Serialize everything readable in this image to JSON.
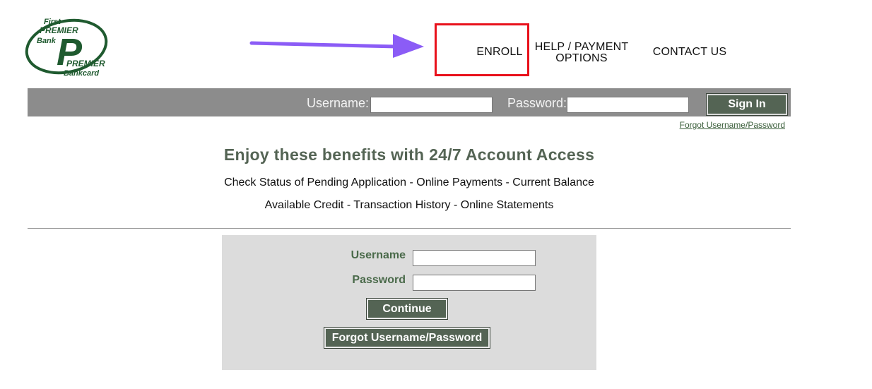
{
  "logo": {
    "line1": "First",
    "line2": "PREMIER",
    "line3": "Bank",
    "line4": "PREMIER",
    "line5": "Bankcard",
    "letter": "P",
    "color": "#1f5a2f"
  },
  "nav": {
    "enroll": "ENROLL",
    "help_line1": "HELP / PAYMENT",
    "help_line2": "OPTIONS",
    "contact": "CONTACT US"
  },
  "annotation": {
    "arrow_color": "#8b5cf6",
    "box_color": "#e8111b"
  },
  "login_bar": {
    "username_label": "Username:",
    "password_label": "Password:",
    "username_value": "",
    "password_value": "",
    "sign_in_label": "Sign In",
    "forgot_link": "Forgot Username/Password"
  },
  "benefits": {
    "title": "Enjoy these benefits with 24/7 Account Access",
    "line1": "Check Status of Pending Application - Online Payments - Current Balance",
    "line2": "Available Credit - Transaction History - Online Statements"
  },
  "login_panel": {
    "username_label": "Username",
    "password_label": "Password",
    "username_value": "",
    "password_value": "",
    "continue_label": "Continue",
    "forgot_label": "Forgot Username/Password"
  },
  "colors": {
    "brand_green": "#546454",
    "bar_gray": "#8c8c8c",
    "panel_gray": "#dcdcdc"
  }
}
